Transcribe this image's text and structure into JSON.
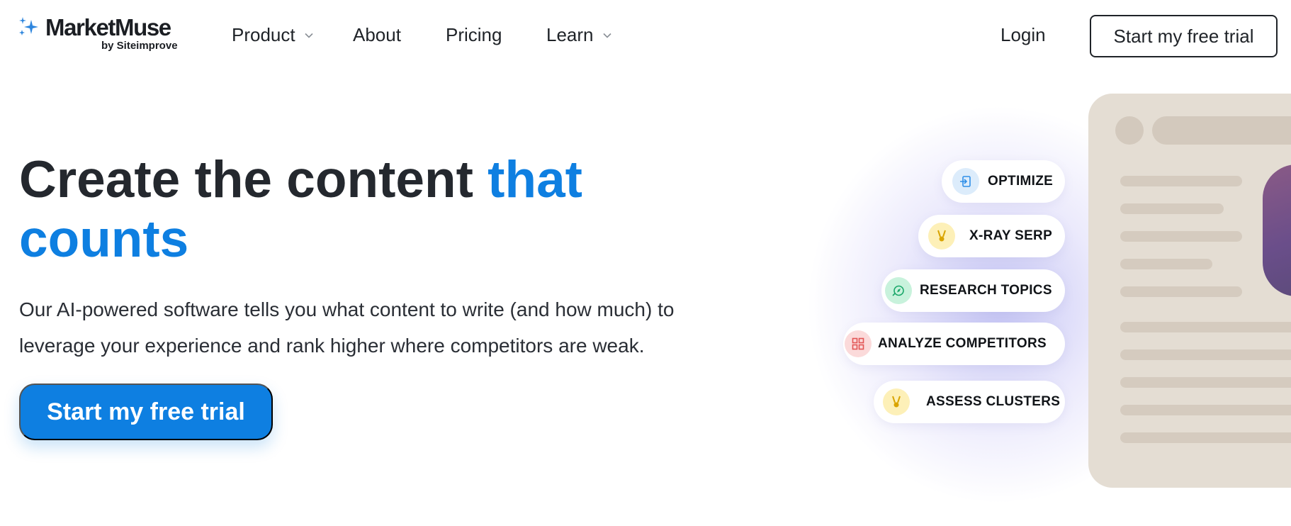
{
  "brand": {
    "name": "MarketMuse",
    "sub": "by Siteimprove",
    "sparkle_color": "#2e86de"
  },
  "nav": {
    "items": [
      {
        "label": "Product",
        "has_dropdown": true
      },
      {
        "label": "About",
        "has_dropdown": false
      },
      {
        "label": "Pricing",
        "has_dropdown": false
      },
      {
        "label": "Learn",
        "has_dropdown": true
      }
    ],
    "login_label": "Login",
    "cta_label": "Start my free trial"
  },
  "hero": {
    "headline_plain": "Create the content ",
    "headline_accent_1": "that",
    "headline_accent_2": "counts",
    "subcopy": "Our AI-powered software tells you what content to write (and how much) to leverage your experience and rank higher where competitors are weak.",
    "cta_label": "Start my free trial"
  },
  "features": [
    {
      "label": "OPTIMIZE",
      "icon": "optimize-icon",
      "icon_color": "#2f8fe8",
      "icon_bg": "#dcecfb"
    },
    {
      "label": "X-RAY SERP",
      "icon": "medal-icon",
      "icon_color": "#d9a400",
      "icon_bg": "#fdf0b8"
    },
    {
      "label": "RESEARCH TOPICS",
      "icon": "compass-icon",
      "icon_color": "#1aa86a",
      "icon_bg": "#c8f2dc"
    },
    {
      "label": "ANALYZE COMPETITORS",
      "icon": "grid-icon",
      "icon_color": "#e25555",
      "icon_bg": "#fbdada"
    },
    {
      "label": "ASSESS CLUSTERS",
      "icon": "medal-icon",
      "icon_color": "#d9a400",
      "icon_bg": "#fdf0b8"
    }
  ],
  "colors": {
    "accent": "#0e7fe1",
    "text": "#24282e",
    "mock_bg": "#e4ddd3"
  }
}
